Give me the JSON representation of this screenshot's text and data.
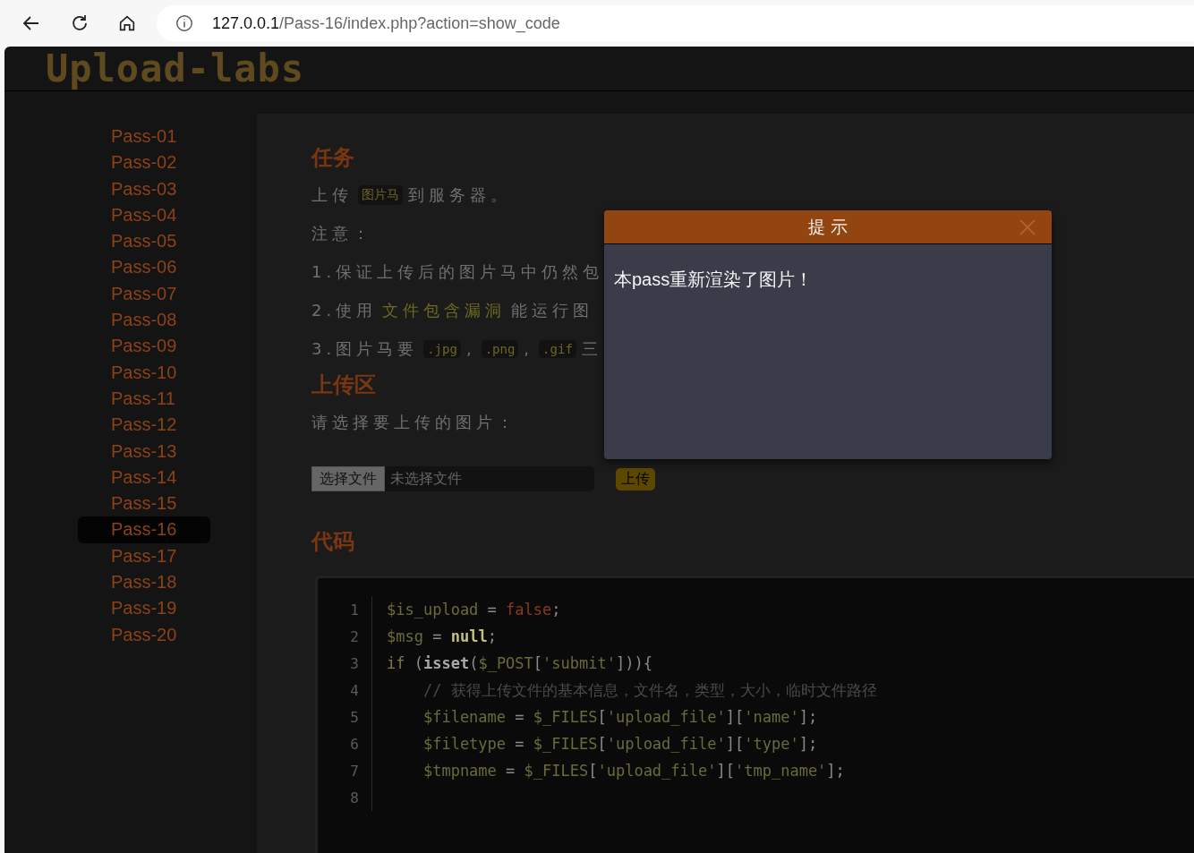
{
  "browser": {
    "url_host": "127.0.0.1",
    "url_path": "/Pass-16/index.php?action=show_code"
  },
  "logo": "Upload-labs",
  "sidebar": {
    "items": [
      {
        "label": "Pass-01",
        "selected": false
      },
      {
        "label": "Pass-02",
        "selected": false
      },
      {
        "label": "Pass-03",
        "selected": false
      },
      {
        "label": "Pass-04",
        "selected": false
      },
      {
        "label": "Pass-05",
        "selected": false
      },
      {
        "label": "Pass-06",
        "selected": false
      },
      {
        "label": "Pass-07",
        "selected": false
      },
      {
        "label": "Pass-08",
        "selected": false
      },
      {
        "label": "Pass-09",
        "selected": false
      },
      {
        "label": "Pass-10",
        "selected": false
      },
      {
        "label": "Pass-11",
        "selected": false
      },
      {
        "label": "Pass-12",
        "selected": false
      },
      {
        "label": "Pass-13",
        "selected": false
      },
      {
        "label": "Pass-14",
        "selected": false
      },
      {
        "label": "Pass-15",
        "selected": false
      },
      {
        "label": "Pass-16",
        "selected": true
      },
      {
        "label": "Pass-17",
        "selected": false
      },
      {
        "label": "Pass-18",
        "selected": false
      },
      {
        "label": "Pass-19",
        "selected": false
      },
      {
        "label": "Pass-20",
        "selected": false
      }
    ]
  },
  "task": {
    "title": "任务",
    "lines": [
      [
        {
          "kind": "plain",
          "text": "上传"
        },
        {
          "kind": "code",
          "text": "图片马"
        },
        {
          "kind": "plain",
          "text": "到服务器。"
        }
      ],
      [
        {
          "kind": "plain",
          "text": "注意："
        }
      ],
      [
        {
          "kind": "plain",
          "text": "1.保证上传后的图片马中仍然包"
        }
      ],
      [
        {
          "kind": "plain",
          "text": "2.使用"
        },
        {
          "kind": "highlight",
          "text": "文件包含漏洞"
        },
        {
          "kind": "plain",
          "text": "能运行图"
        }
      ],
      [
        {
          "kind": "plain",
          "text": "3.图片马要"
        },
        {
          "kind": "code",
          "text": ".jpg"
        },
        {
          "kind": "plain",
          "text": ","
        },
        {
          "kind": "code",
          "text": ".png"
        },
        {
          "kind": "plain",
          "text": ","
        },
        {
          "kind": "code",
          "text": ".gif"
        },
        {
          "kind": "plain",
          "text": "三"
        }
      ]
    ]
  },
  "upload": {
    "title": "上传区",
    "prompt": "请选择要上传的图片：",
    "choose_button": "选择文件",
    "file_status": "未选择文件",
    "submit_button": "上传"
  },
  "code": {
    "title": "代码",
    "lines": [
      {
        "number": "1",
        "tokens": [
          {
            "kind": "var",
            "text": "$is_upload"
          },
          {
            "kind": "punct",
            "text": " = "
          },
          {
            "kind": "literal",
            "text": "false"
          },
          {
            "kind": "punct",
            "text": ";"
          }
        ]
      },
      {
        "number": "2",
        "tokens": [
          {
            "kind": "var",
            "text": "$msg"
          },
          {
            "kind": "punct",
            "text": " = "
          },
          {
            "kind": "const",
            "text": "null"
          },
          {
            "kind": "punct",
            "text": ";"
          }
        ]
      },
      {
        "number": "3",
        "tokens": [
          {
            "kind": "keyword",
            "text": "if"
          },
          {
            "kind": "punct",
            "text": " ("
          },
          {
            "kind": "func",
            "text": "isset"
          },
          {
            "kind": "punct",
            "text": "("
          },
          {
            "kind": "var",
            "text": "$_POST"
          },
          {
            "kind": "punct",
            "text": "["
          },
          {
            "kind": "string",
            "text": "'submit'"
          },
          {
            "kind": "punct",
            "text": "])){"
          }
        ]
      },
      {
        "number": "4",
        "tokens": [
          {
            "kind": "comment",
            "text": "    // 获得上传文件的基本信息，文件名，类型，大小，临时文件路径"
          }
        ]
      },
      {
        "number": "5",
        "tokens": [
          {
            "kind": "var",
            "text": "    $filename"
          },
          {
            "kind": "punct",
            "text": " = "
          },
          {
            "kind": "var",
            "text": "$_FILES"
          },
          {
            "kind": "punct",
            "text": "["
          },
          {
            "kind": "string",
            "text": "'upload_file'"
          },
          {
            "kind": "punct",
            "text": "]["
          },
          {
            "kind": "string",
            "text": "'name'"
          },
          {
            "kind": "punct",
            "text": "];"
          }
        ]
      },
      {
        "number": "6",
        "tokens": [
          {
            "kind": "var",
            "text": "    $filetype"
          },
          {
            "kind": "punct",
            "text": " = "
          },
          {
            "kind": "var",
            "text": "$_FILES"
          },
          {
            "kind": "punct",
            "text": "["
          },
          {
            "kind": "string",
            "text": "'upload_file'"
          },
          {
            "kind": "punct",
            "text": "]["
          },
          {
            "kind": "string",
            "text": "'type'"
          },
          {
            "kind": "punct",
            "text": "];"
          }
        ]
      },
      {
        "number": "7",
        "tokens": [
          {
            "kind": "var",
            "text": "    $tmpname"
          },
          {
            "kind": "punct",
            "text": " = "
          },
          {
            "kind": "var",
            "text": "$_FILES"
          },
          {
            "kind": "punct",
            "text": "["
          },
          {
            "kind": "string",
            "text": "'upload_file'"
          },
          {
            "kind": "punct",
            "text": "]["
          },
          {
            "kind": "string",
            "text": "'tmp_name'"
          },
          {
            "kind": "punct",
            "text": "];"
          }
        ]
      },
      {
        "number": "8"
      }
    ]
  },
  "dialog": {
    "title": "提 示",
    "message": "本pass重新渲染了图片！"
  }
}
